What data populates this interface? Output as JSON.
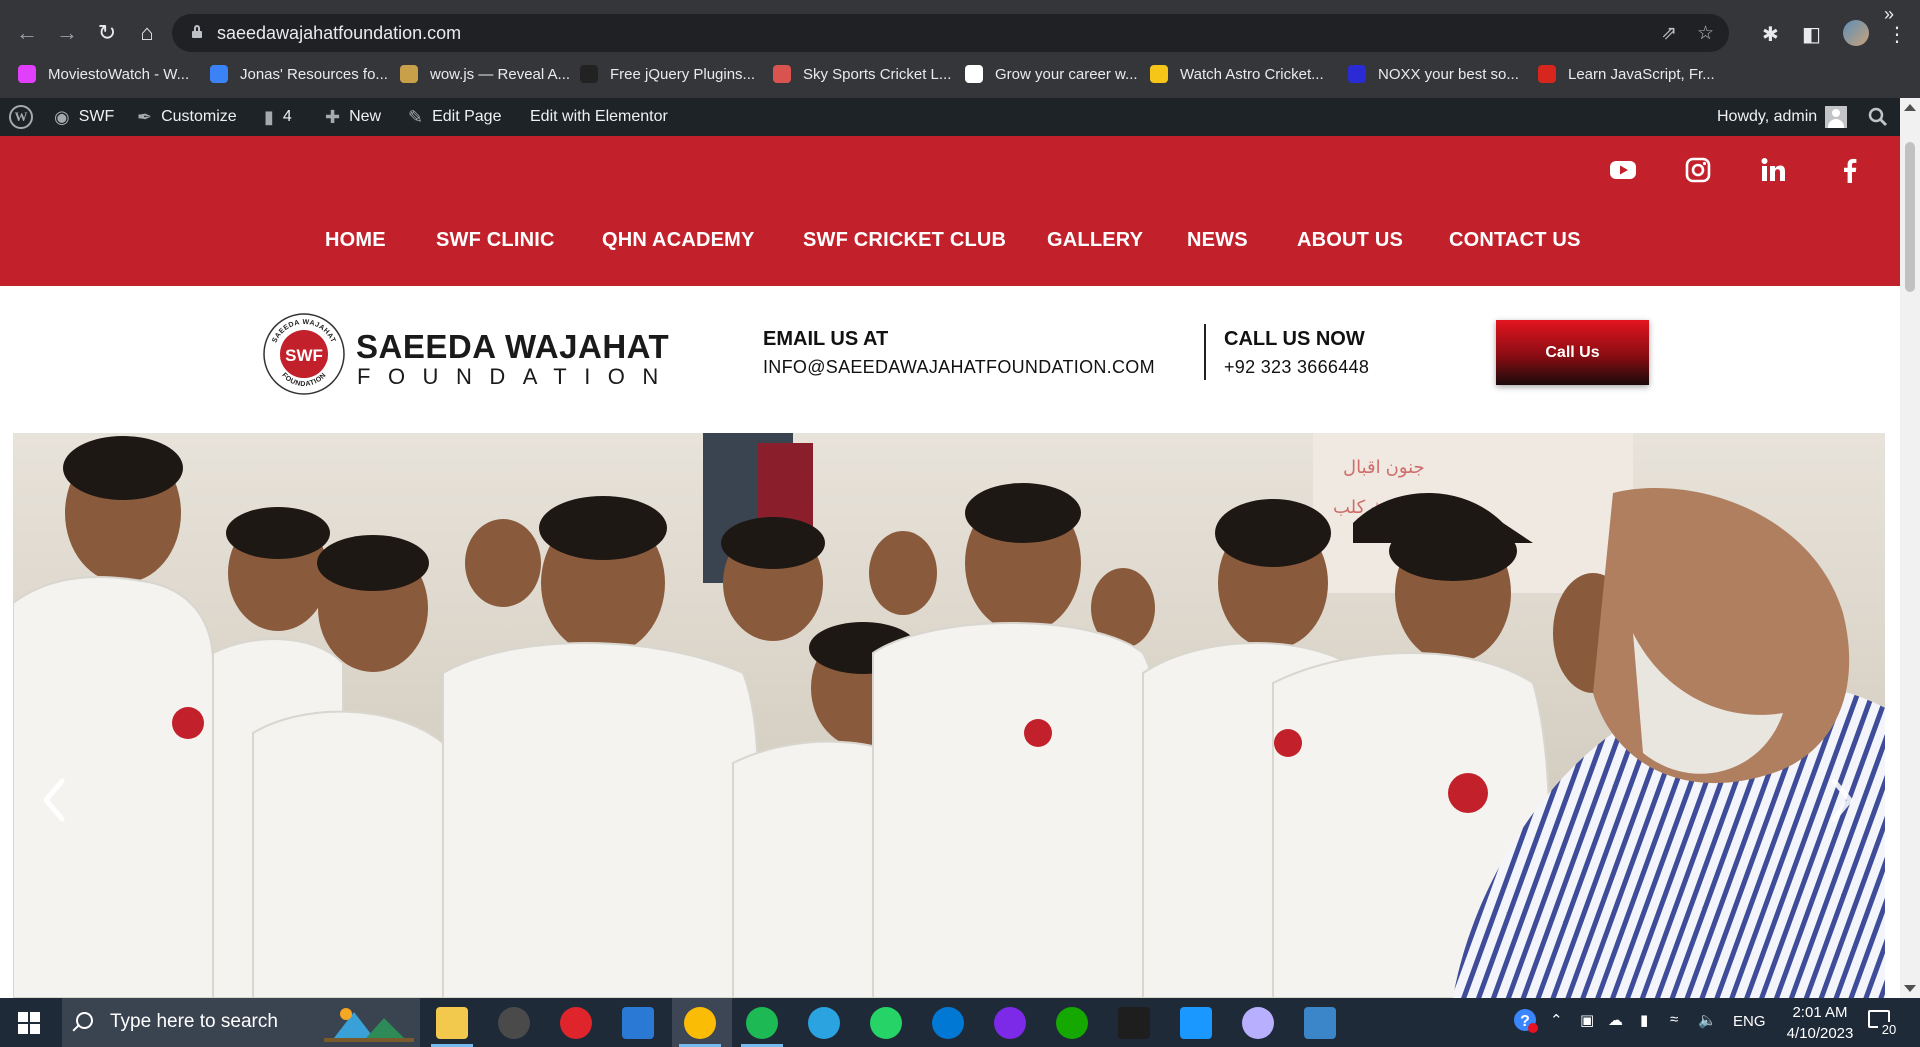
{
  "browser": {
    "url": "saeedawajahatfoundation.com",
    "bookmarks": [
      {
        "label": "MoviestoWatch - W...",
        "color": "#e040fb"
      },
      {
        "label": "Jonas' Resources fo...",
        "color": "#3b82f6"
      },
      {
        "label": "wow.js — Reveal A...",
        "color": "#c8a04a"
      },
      {
        "label": "Free jQuery Plugins...",
        "color": "#222222"
      },
      {
        "label": "Sky Sports Cricket L...",
        "color": "#d9534f"
      },
      {
        "label": "Grow your career w...",
        "color": "#ffffff"
      },
      {
        "label": "Watch Astro Cricket...",
        "color": "#f5c518"
      },
      {
        "label": "NOXX your best so...",
        "color": "#2b2bd6"
      },
      {
        "label": "Learn JavaScript, Fr...",
        "color": "#d7261e"
      }
    ],
    "more_bookmarks": "»"
  },
  "wp_admin": {
    "site_name": "SWF",
    "customize": "Customize",
    "comments_count": "4",
    "new_label": "New",
    "edit_page": "Edit Page",
    "edit_elementor": "Edit with Elementor",
    "howdy": "Howdy, admin"
  },
  "site": {
    "brand_color": "#c2202a",
    "social_icons": [
      "youtube-icon",
      "instagram-icon",
      "linkedin-icon",
      "facebook-icon"
    ],
    "menu": [
      "HOME",
      "SWF CLINIC",
      "QHN ACADEMY",
      "SWF CRICKET CLUB",
      "GALLERY",
      "NEWS",
      "ABOUT US",
      "CONTACT US"
    ],
    "logo": {
      "seal_text": "SWF",
      "ring_top": "SAEEDA WAJAHAT",
      "ring_bottom": "FOUNDATION",
      "name_line1": "SAEEDA WAJAHAT",
      "name_line2": "FOUNDATION"
    },
    "email_heading": "EMAIL US AT",
    "email": "INFO@SAEEDAWAJAHATFOUNDATION.COM",
    "call_heading": "CALL US NOW",
    "phone": "+92 323 3666448",
    "call_button": "Call Us"
  },
  "taskbar": {
    "search_placeholder": "Type here to search",
    "apps": [
      "file-explorer",
      "obs",
      "opera",
      "vscode",
      "chrome",
      "spotify",
      "telegram",
      "whatsapp",
      "skype",
      "canva",
      "upwork",
      "figma",
      "prime-video",
      "arc",
      "photos"
    ],
    "language": "ENG",
    "time": "2:01 AM",
    "date": "4/10/2023",
    "notifications": "20"
  }
}
